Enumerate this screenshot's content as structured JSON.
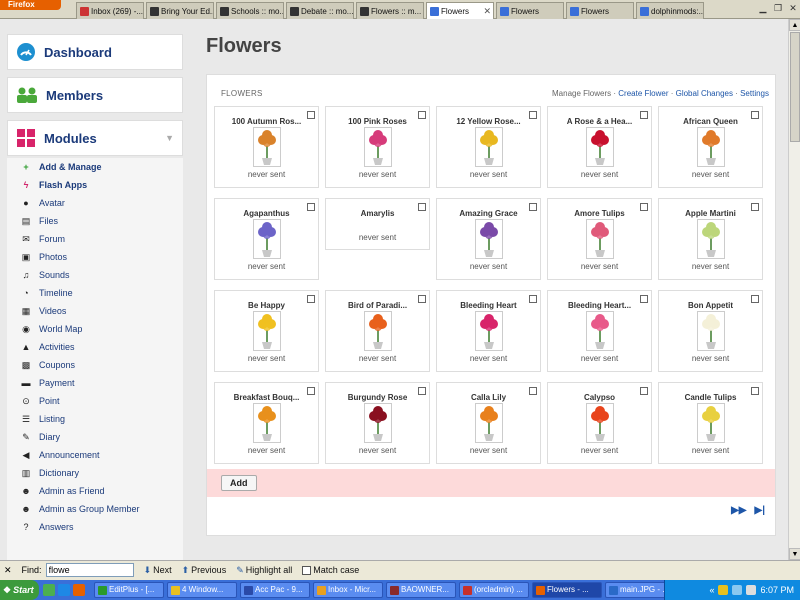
{
  "browser": {
    "brand": "Firefox",
    "tabs": [
      {
        "label": "Inbox (269) -...",
        "fav": "#c33",
        "active": false
      },
      {
        "label": "Bring Your Ed...",
        "fav": "#333",
        "active": false
      },
      {
        "label": "Schools :: mo...",
        "fav": "#333",
        "active": false
      },
      {
        "label": "Debate :: mo...",
        "fav": "#333",
        "active": false
      },
      {
        "label": "Flowers :: m...",
        "fav": "#333",
        "active": false
      },
      {
        "label": "Flowers",
        "fav": "#3a6fd8",
        "active": true
      },
      {
        "label": "Flowers",
        "fav": "#3a6fd8",
        "active": false
      },
      {
        "label": "Flowers",
        "fav": "#3a6fd8",
        "active": false
      },
      {
        "label": "dolphinmods:...",
        "fav": "#3a6fd8",
        "active": false
      }
    ]
  },
  "sidebar": {
    "dashboard": "Dashboard",
    "members": "Members",
    "modules": "Modules",
    "items": [
      {
        "label": "Add & Manage",
        "icon": "plus-icon",
        "glyph": "+",
        "bold": true,
        "color": "#2a9a2a"
      },
      {
        "label": "Flash Apps",
        "icon": "lightning-icon",
        "glyph": "ϟ",
        "bold": true,
        "color": "#d0246a"
      },
      {
        "label": "Avatar",
        "icon": "avatar-icon",
        "glyph": "●",
        "bold": false,
        "color": "#222"
      },
      {
        "label": "Files",
        "icon": "files-icon",
        "glyph": "▤",
        "bold": false,
        "color": "#222"
      },
      {
        "label": "Forum",
        "icon": "forum-icon",
        "glyph": "✉",
        "bold": false,
        "color": "#222"
      },
      {
        "label": "Photos",
        "icon": "photos-icon",
        "glyph": "▣",
        "bold": false,
        "color": "#222"
      },
      {
        "label": "Sounds",
        "icon": "sounds-icon",
        "glyph": "♫",
        "bold": false,
        "color": "#222"
      },
      {
        "label": "Timeline",
        "icon": "timeline-icon",
        "glyph": "◔",
        "bold": false,
        "color": "#222"
      },
      {
        "label": "Videos",
        "icon": "videos-icon",
        "glyph": "▦",
        "bold": false,
        "color": "#222"
      },
      {
        "label": "World Map",
        "icon": "world-map-icon",
        "glyph": "◉",
        "bold": false,
        "color": "#222"
      },
      {
        "label": "Activities",
        "icon": "activities-icon",
        "glyph": "▲",
        "bold": false,
        "color": "#222"
      },
      {
        "label": "Coupons",
        "icon": "coupons-icon",
        "glyph": "▩",
        "bold": false,
        "color": "#222"
      },
      {
        "label": "Payment",
        "icon": "payment-icon",
        "glyph": "▬",
        "bold": false,
        "color": "#222"
      },
      {
        "label": "Point",
        "icon": "point-icon",
        "glyph": "⊙",
        "bold": false,
        "color": "#222"
      },
      {
        "label": "Listing",
        "icon": "listing-icon",
        "glyph": "☰",
        "bold": false,
        "color": "#222"
      },
      {
        "label": "Diary",
        "icon": "diary-icon",
        "glyph": "✎",
        "bold": false,
        "color": "#222"
      },
      {
        "label": "Announcement",
        "icon": "announcement-icon",
        "glyph": "◀",
        "bold": false,
        "color": "#222"
      },
      {
        "label": "Dictionary",
        "icon": "dictionary-icon",
        "glyph": "▥",
        "bold": false,
        "color": "#222"
      },
      {
        "label": "Admin as Friend",
        "icon": "friend-icon",
        "glyph": "☻",
        "bold": false,
        "color": "#222"
      },
      {
        "label": "Admin as Group Member",
        "icon": "group-icon",
        "glyph": "☻",
        "bold": false,
        "color": "#222"
      },
      {
        "label": "Answers",
        "icon": "answers-icon",
        "glyph": "?",
        "bold": false,
        "color": "#222"
      }
    ]
  },
  "main": {
    "title": "Flowers",
    "panel_header": "FLOWERS",
    "links": {
      "manage": "Manage Flowers",
      "create": "Create Flower",
      "global": "Global Changes",
      "settings": "Settings"
    },
    "add_label": "Add",
    "status_default": "never sent",
    "flowers": [
      {
        "name": "100 Autumn Ros...",
        "color": "#d9822b",
        "has_image": true
      },
      {
        "name": "100 Pink Roses",
        "color": "#d63b7a",
        "has_image": true
      },
      {
        "name": "12 Yellow Rose...",
        "color": "#e8b820",
        "has_image": true
      },
      {
        "name": "A Rose & a Hea...",
        "color": "#c8102e",
        "has_image": true
      },
      {
        "name": "African Queen",
        "color": "#e07a2a",
        "has_image": true
      },
      {
        "name": "Agapanthus",
        "color": "#6c64c8",
        "has_image": true
      },
      {
        "name": "Amarylis",
        "color": "#ffffff",
        "has_image": false
      },
      {
        "name": "Amazing Grace",
        "color": "#7a4aa8",
        "has_image": true
      },
      {
        "name": "Amore Tulips",
        "color": "#e05a7a",
        "has_image": true
      },
      {
        "name": "Apple Martini",
        "color": "#bcd67a",
        "has_image": true
      },
      {
        "name": "Be Happy",
        "color": "#f0c020",
        "has_image": true
      },
      {
        "name": "Bird of Paradi...",
        "color": "#e8601c",
        "has_image": true
      },
      {
        "name": "Bleeding Heart",
        "color": "#d8246a",
        "has_image": true
      },
      {
        "name": "Bleeding Heart...",
        "color": "#e85a8a",
        "has_image": true
      },
      {
        "name": "Bon Appetit",
        "color": "#f4f0d8",
        "has_image": true
      },
      {
        "name": "Breakfast Bouq...",
        "color": "#e8901c",
        "has_image": true
      },
      {
        "name": "Burgundy Rose",
        "color": "#8a1020",
        "has_image": true
      },
      {
        "name": "Calla Lily",
        "color": "#e8801c",
        "has_image": true
      },
      {
        "name": "Calypso",
        "color": "#e8441c",
        "has_image": true
      },
      {
        "name": "Candle Tulips",
        "color": "#e8d040",
        "has_image": true
      }
    ]
  },
  "findbar": {
    "label": "Find:",
    "value": "flowe",
    "next": "Next",
    "previous": "Previous",
    "highlight": "Highlight all",
    "match_case": "Match case"
  },
  "taskbar": {
    "start": "Start",
    "tasks": [
      {
        "label": "EditPlus - [...",
        "fav": "#2a9a2a",
        "active": false
      },
      {
        "label": "4 Window...",
        "fav": "#e8c020",
        "active": false
      },
      {
        "label": "Acc Pac - 9...",
        "fav": "#2a4aa8",
        "active": false
      },
      {
        "label": "Inbox - Micr...",
        "fav": "#e8a020",
        "active": false
      },
      {
        "label": "BAOWNER...",
        "fav": "#8a2a2a",
        "active": false
      },
      {
        "label": "(orcladmin) ...",
        "fav": "#c8302a",
        "active": false
      },
      {
        "label": "Flowers - ...",
        "fav": "#e66000",
        "active": true
      },
      {
        "label": "main.JPG - ...",
        "fav": "#2a6ac8",
        "active": false
      }
    ],
    "clock": "6:07 PM"
  }
}
